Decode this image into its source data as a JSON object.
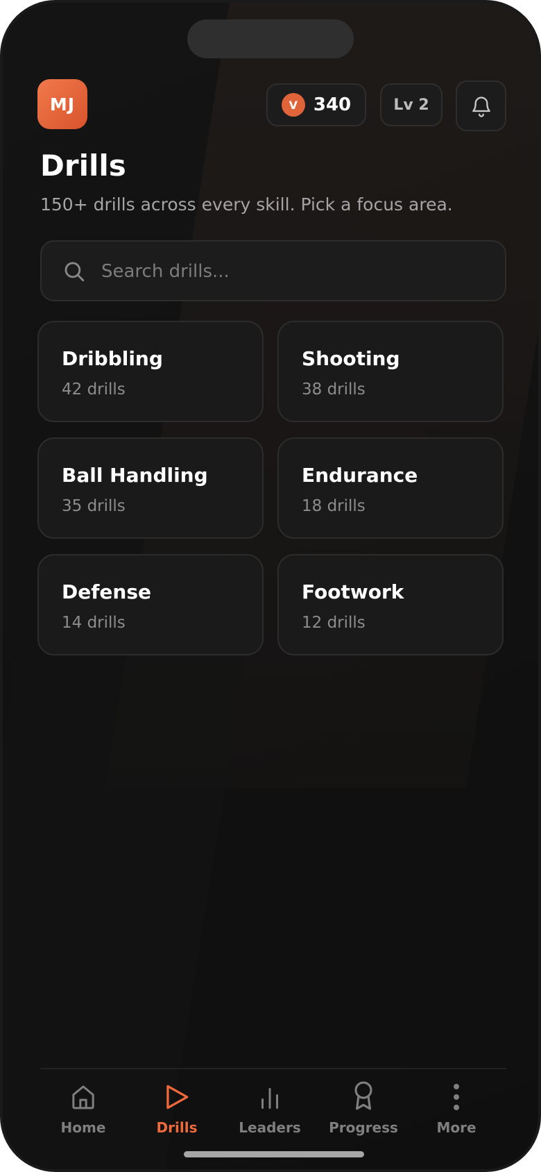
{
  "header": {
    "avatar_initials": "MJ",
    "coins": {
      "badge_letter": "V",
      "count": "340"
    },
    "level_label": "Lv 2"
  },
  "page": {
    "title": "Drills",
    "subtitle": "150+ drills across every skill. Pick a focus area."
  },
  "search": {
    "placeholder": "Search drills..."
  },
  "categories": [
    {
      "name": "Dribbling",
      "count": "42 drills"
    },
    {
      "name": "Shooting",
      "count": "38 drills"
    },
    {
      "name": "Ball Handling",
      "count": "35 drills"
    },
    {
      "name": "Endurance",
      "count": "18 drills"
    },
    {
      "name": "Defense",
      "count": "14 drills"
    },
    {
      "name": "Footwork",
      "count": "12 drills"
    }
  ],
  "tabs": [
    {
      "label": "Home",
      "icon": "home-icon",
      "active": false
    },
    {
      "label": "Drills",
      "icon": "play-icon",
      "active": true
    },
    {
      "label": "Leaders",
      "icon": "bar-chart-icon",
      "active": false
    },
    {
      "label": "Progress",
      "icon": "award-icon",
      "active": false
    },
    {
      "label": "More",
      "icon": "more-vertical-icon",
      "active": false
    }
  ],
  "colors": {
    "accent": "#ee6a3c",
    "background": "#111111",
    "card": "#1a1a1a",
    "muted_text": "#8d8d8d"
  }
}
